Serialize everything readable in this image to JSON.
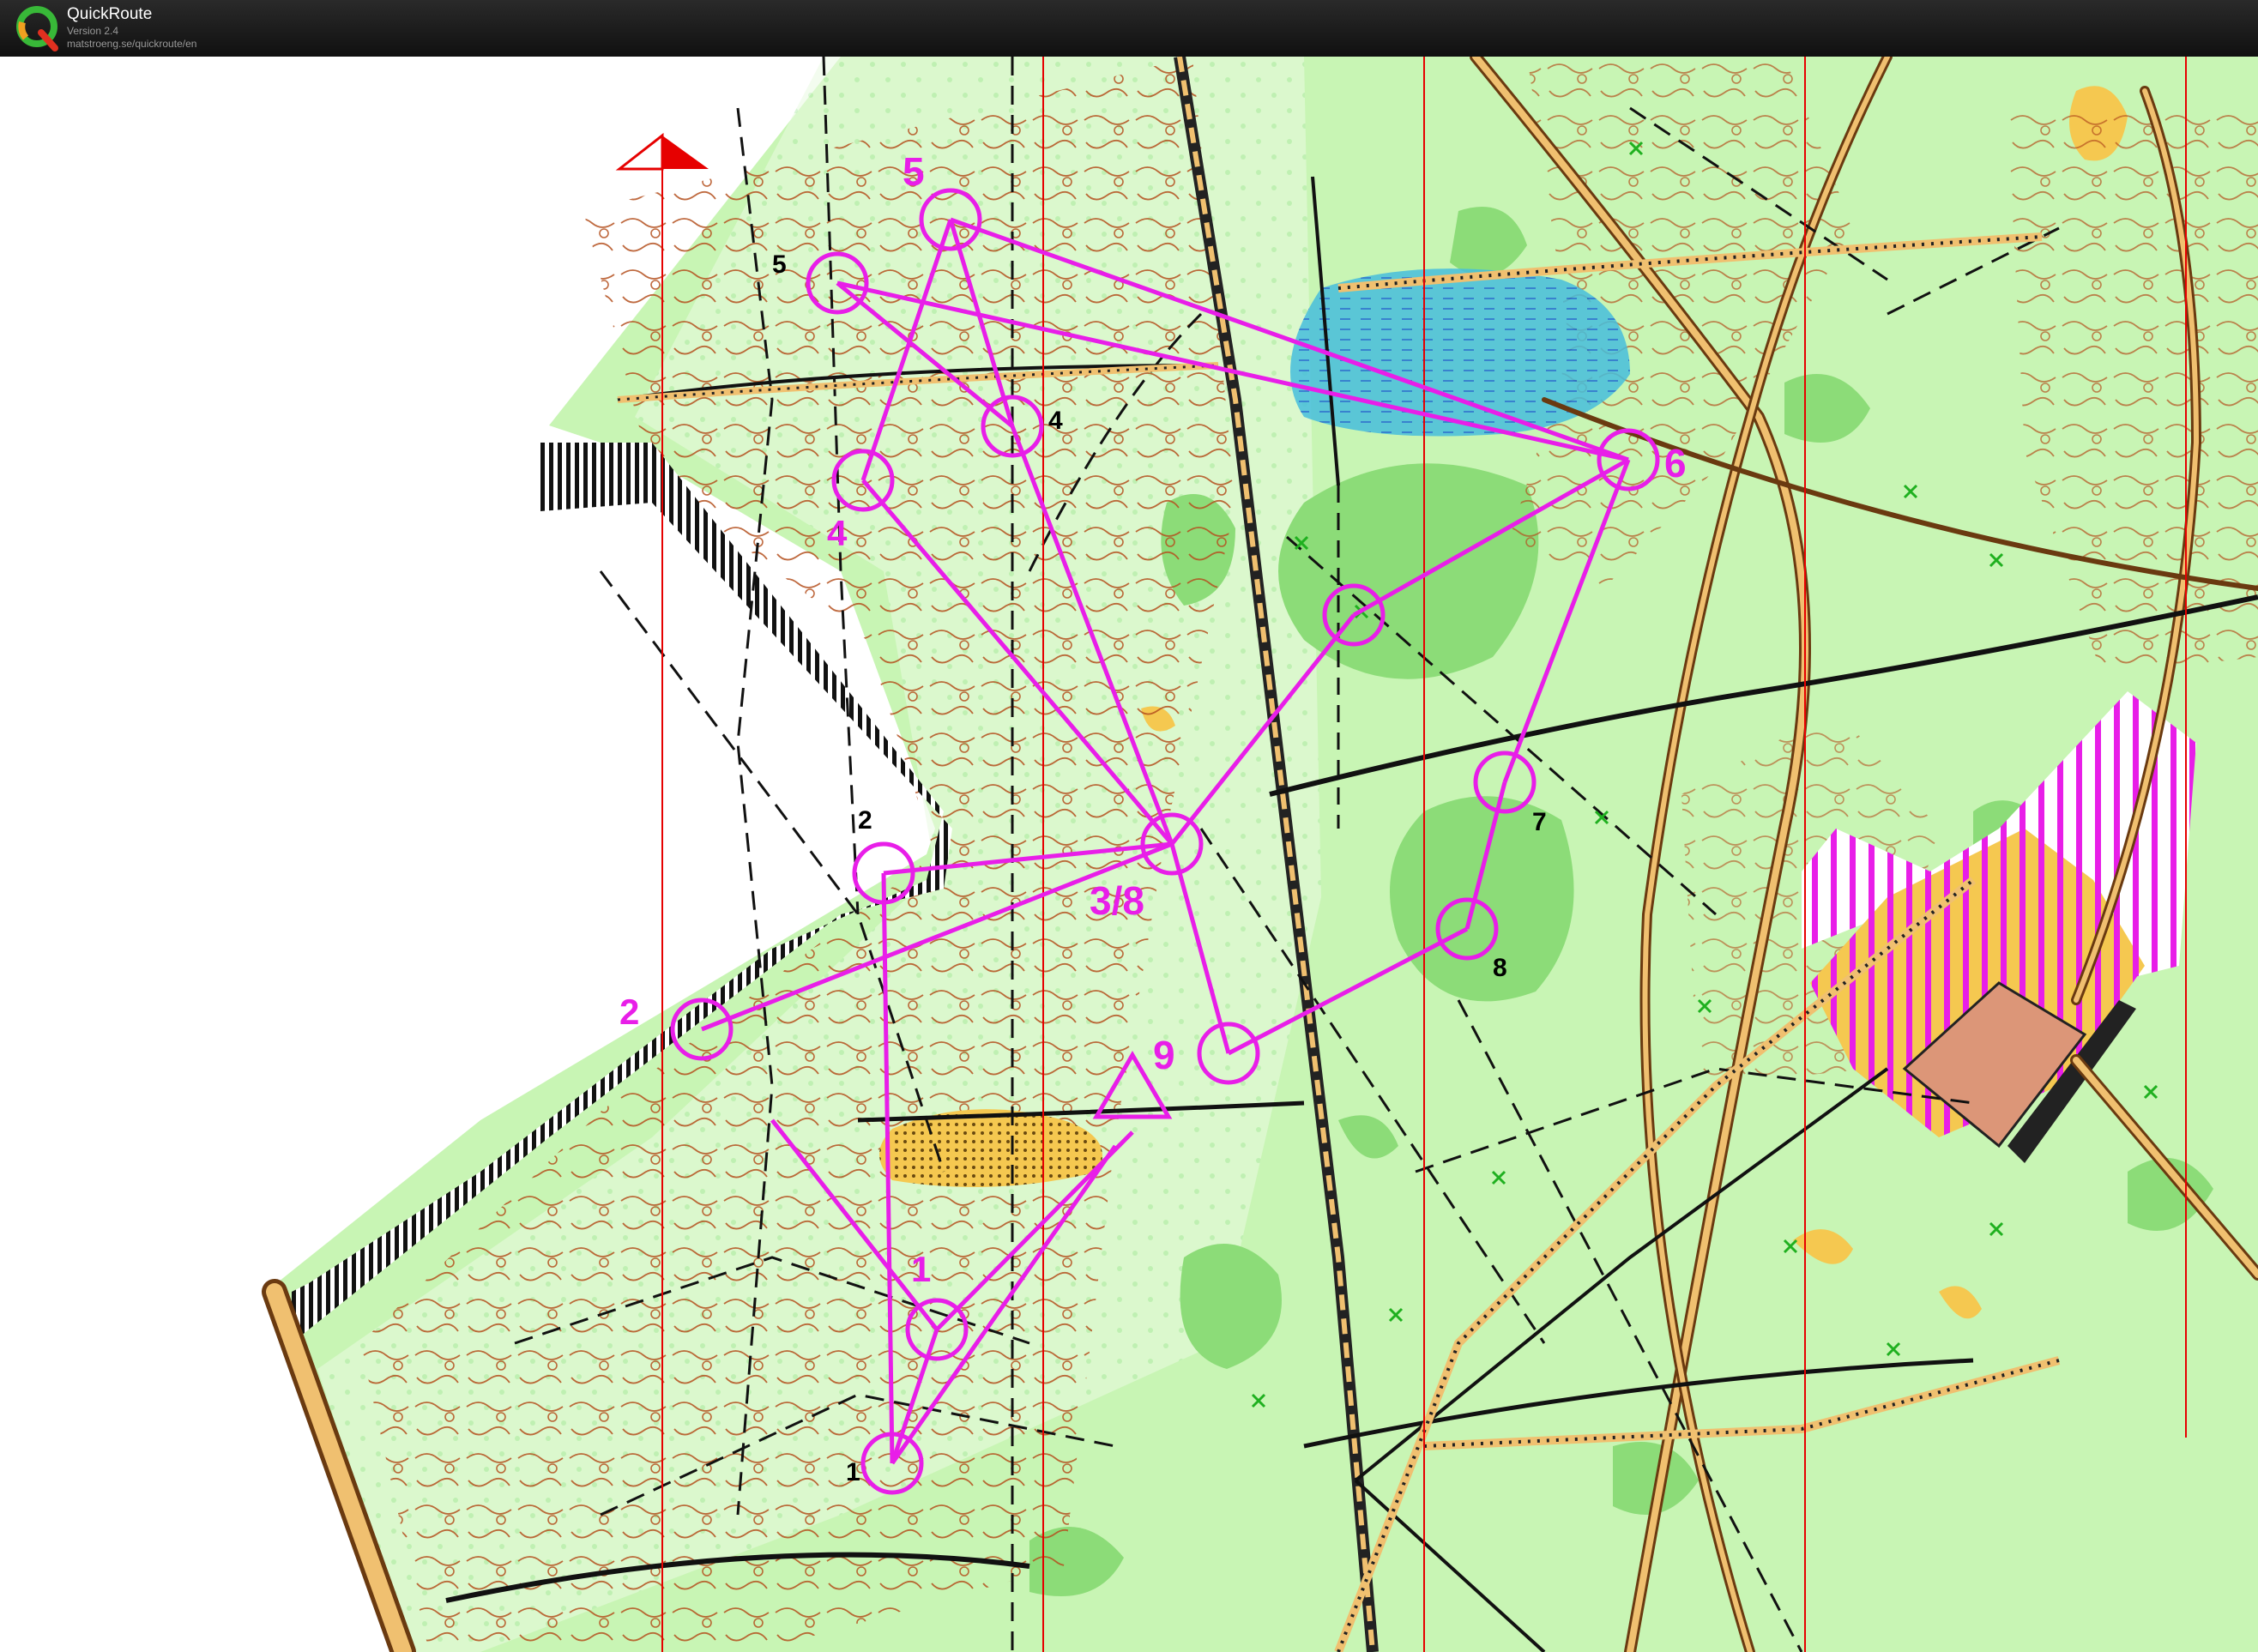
{
  "app": {
    "title": "QuickRoute",
    "version": "Version 2.4",
    "url": "matstroeng.se/quickroute/en",
    "icon": "quickroute-q-logo-icon"
  },
  "colors": {
    "course": "#e81ee8",
    "forest_light": "#c8f5b4",
    "forest_dark": "#8cdc78",
    "contour": "#b4501e",
    "water": "#46bedc",
    "open_land": "#f5c850",
    "north_arrow": "#e60000",
    "building": "#dc9678"
  },
  "course": {
    "start_symbol": "start-triangle-icon",
    "controls": [
      {
        "id": "c1",
        "label": "1"
      },
      {
        "id": "c2",
        "label": "2"
      },
      {
        "id": "c38",
        "label": "3/8"
      },
      {
        "id": "c4",
        "label": "4"
      },
      {
        "id": "c5",
        "label": "5"
      },
      {
        "id": "c6",
        "label": "6"
      },
      {
        "id": "c7",
        "label": "7"
      },
      {
        "id": "c8",
        "label": "8"
      },
      {
        "id": "c9",
        "label": "9"
      }
    ]
  },
  "map_labels": [
    "1",
    "2",
    "4",
    "5",
    "7",
    "8"
  ]
}
